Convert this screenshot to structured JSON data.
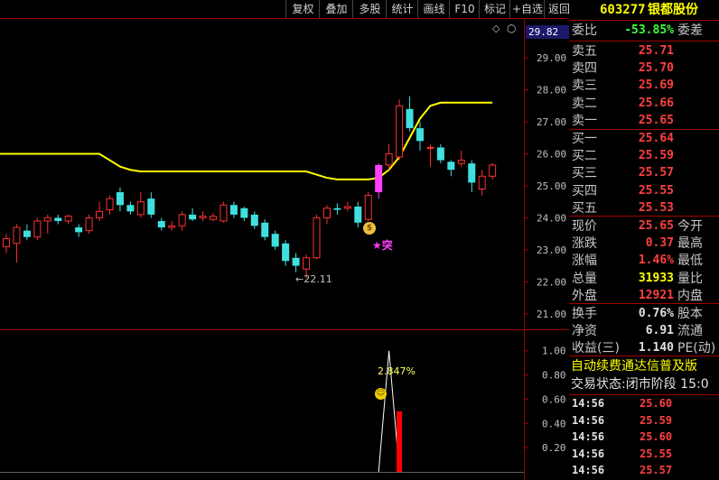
{
  "toolbar": {
    "buttons": [
      "复权",
      "叠加",
      "多股",
      "统计",
      "画线",
      "F10",
      "标记",
      "+自选",
      "返回"
    ]
  },
  "stock": {
    "code": "603277",
    "name": "银都股份"
  },
  "colors": {
    "up": "#ff3030",
    "down": "#40e0e0",
    "ma": "#ffff00",
    "flag": "#ff40ff",
    "axis": "#a00000"
  },
  "price_axis": {
    "top_label": "29.82",
    "ticks": [
      "29.00",
      "28.00",
      "27.00",
      "26.00",
      "25.00",
      "24.00",
      "23.00",
      "22.00",
      "21.00"
    ]
  },
  "indicator_axis": {
    "ticks": [
      "1.00",
      "0.80",
      "0.60",
      "0.40",
      "0.20"
    ]
  },
  "annotations": {
    "low_marker": "←22.11",
    "flag_text": "★突",
    "pct_label": "2.847%"
  },
  "quote": {
    "weibi": {
      "label": "委比",
      "value": "-53.85%",
      "label2": "委差"
    },
    "asks": [
      {
        "label": "卖五",
        "price": "25.71"
      },
      {
        "label": "卖四",
        "price": "25.70"
      },
      {
        "label": "卖三",
        "price": "25.69"
      },
      {
        "label": "卖二",
        "price": "25.66"
      },
      {
        "label": "卖一",
        "price": "25.65"
      }
    ],
    "bids": [
      {
        "label": "买一",
        "price": "25.64"
      },
      {
        "label": "买二",
        "price": "25.59"
      },
      {
        "label": "买三",
        "price": "25.57"
      },
      {
        "label": "买四",
        "price": "25.55"
      },
      {
        "label": "买五",
        "price": "25.53"
      }
    ],
    "stats": [
      {
        "label": "现价",
        "value": "25.65",
        "label2": "今开",
        "color": "#ff4040"
      },
      {
        "label": "涨跌",
        "value": "0.37",
        "label2": "最高",
        "color": "#ff4040"
      },
      {
        "label": "涨幅",
        "value": "1.46%",
        "label2": "最低",
        "color": "#ff4040"
      },
      {
        "label": "总量",
        "value": "31933",
        "label2": "量比",
        "color": "#ffff00"
      },
      {
        "label": "外盘",
        "value": "12921",
        "label2": "内盘",
        "color": "#ff4040"
      }
    ],
    "stats2": [
      {
        "label": "换手",
        "value": "0.76%",
        "label2": "股本",
        "color": "#e0e0e0"
      },
      {
        "label": "净资",
        "value": "6.91",
        "label2": "流通",
        "color": "#e0e0e0"
      },
      {
        "label": "收益(三)",
        "value": "1.140",
        "label2": "PE(动)",
        "color": "#e0e0e0"
      }
    ]
  },
  "banner": "自动续费通达信普及版",
  "trade_status": "交易状态:闭市阶段 15:0",
  "trades": [
    {
      "time": "14:56",
      "price": "25.60"
    },
    {
      "time": "14:56",
      "price": "25.59"
    },
    {
      "time": "14:56",
      "price": "25.60"
    },
    {
      "time": "14:56",
      "price": "25.55"
    },
    {
      "time": "14:56",
      "price": "25.57"
    }
  ],
  "chart_data": {
    "type": "candlestick",
    "ylim": [
      20.6,
      29.82
    ],
    "candles": [
      {
        "o": 23.1,
        "c": 23.35,
        "h": 23.5,
        "l": 22.9
      },
      {
        "o": 23.2,
        "c": 23.7,
        "h": 23.8,
        "l": 22.6
      },
      {
        "o": 23.6,
        "c": 23.4,
        "h": 23.8,
        "l": 23.3
      },
      {
        "o": 23.4,
        "c": 23.9,
        "h": 24.0,
        "l": 23.3
      },
      {
        "o": 23.9,
        "c": 24.0,
        "h": 24.1,
        "l": 23.5
      },
      {
        "o": 24.0,
        "c": 23.9,
        "h": 24.1,
        "l": 23.8
      },
      {
        "o": 23.9,
        "c": 24.05,
        "h": 24.1,
        "l": 23.8
      },
      {
        "o": 23.7,
        "c": 23.55,
        "h": 23.8,
        "l": 23.4
      },
      {
        "o": 23.6,
        "c": 24.0,
        "h": 24.1,
        "l": 23.5
      },
      {
        "o": 24.0,
        "c": 24.2,
        "h": 24.5,
        "l": 23.9
      },
      {
        "o": 24.25,
        "c": 24.6,
        "h": 24.7,
        "l": 24.1
      },
      {
        "o": 24.8,
        "c": 24.4,
        "h": 24.95,
        "l": 24.2
      },
      {
        "o": 24.4,
        "c": 24.2,
        "h": 24.5,
        "l": 24.1
      },
      {
        "o": 24.1,
        "c": 24.5,
        "h": 24.8,
        "l": 24.0
      },
      {
        "o": 24.6,
        "c": 24.1,
        "h": 24.8,
        "l": 24.0
      },
      {
        "o": 23.9,
        "c": 23.7,
        "h": 24.0,
        "l": 23.6
      },
      {
        "o": 23.7,
        "c": 23.75,
        "h": 23.9,
        "l": 23.6
      },
      {
        "o": 23.75,
        "c": 24.1,
        "h": 24.2,
        "l": 23.6
      },
      {
        "o": 24.1,
        "c": 23.95,
        "h": 24.3,
        "l": 23.9
      },
      {
        "o": 24.0,
        "c": 24.05,
        "h": 24.2,
        "l": 23.9
      },
      {
        "o": 23.95,
        "c": 24.05,
        "h": 24.15,
        "l": 23.9
      },
      {
        "o": 23.9,
        "c": 24.4,
        "h": 24.5,
        "l": 23.85
      },
      {
        "o": 24.4,
        "c": 24.1,
        "h": 24.5,
        "l": 24.0
      },
      {
        "o": 24.3,
        "c": 24.0,
        "h": 24.35,
        "l": 23.9
      },
      {
        "o": 24.1,
        "c": 23.75,
        "h": 24.2,
        "l": 23.65
      },
      {
        "o": 23.85,
        "c": 23.4,
        "h": 23.95,
        "l": 23.3
      },
      {
        "o": 23.5,
        "c": 23.1,
        "h": 23.6,
        "l": 23.0
      },
      {
        "o": 23.2,
        "c": 22.65,
        "h": 23.3,
        "l": 22.5
      },
      {
        "o": 22.75,
        "c": 22.5,
        "h": 22.9,
        "l": 22.3
      },
      {
        "o": 22.4,
        "c": 22.75,
        "h": 22.85,
        "l": 22.11
      },
      {
        "o": 22.75,
        "c": 24.0,
        "h": 24.1,
        "l": 22.7
      },
      {
        "o": 24.0,
        "c": 24.3,
        "h": 24.4,
        "l": 23.8
      },
      {
        "o": 24.3,
        "c": 24.25,
        "h": 24.45,
        "l": 24.1
      },
      {
        "o": 24.3,
        "c": 24.35,
        "h": 24.5,
        "l": 24.2
      },
      {
        "o": 24.35,
        "c": 23.85,
        "h": 24.5,
        "l": 23.7
      },
      {
        "o": 23.95,
        "c": 24.7,
        "h": 24.8,
        "l": 23.9
      },
      {
        "o": 24.8,
        "c": 25.65,
        "h": 25.7,
        "l": 24.6
      },
      {
        "o": 25.65,
        "c": 26.0,
        "h": 26.3,
        "l": 25.5
      },
      {
        "o": 25.9,
        "c": 27.5,
        "h": 27.7,
        "l": 25.8
      },
      {
        "o": 27.4,
        "c": 26.8,
        "h": 27.8,
        "l": 26.7
      },
      {
        "o": 26.8,
        "c": 26.4,
        "h": 27.0,
        "l": 26.1
      },
      {
        "o": 26.2,
        "c": 26.2,
        "h": 26.3,
        "l": 25.6
      },
      {
        "o": 26.2,
        "c": 25.8,
        "h": 26.3,
        "l": 25.7
      },
      {
        "o": 25.75,
        "c": 25.5,
        "h": 25.8,
        "l": 25.3
      },
      {
        "o": 25.7,
        "c": 25.8,
        "h": 26.1,
        "l": 25.6
      },
      {
        "o": 25.7,
        "c": 25.1,
        "h": 25.8,
        "l": 24.8
      },
      {
        "o": 24.9,
        "c": 25.3,
        "h": 25.5,
        "l": 24.7
      },
      {
        "o": 25.3,
        "c": 25.65,
        "h": 25.71,
        "l": 25.2
      }
    ],
    "ma": [
      26.0,
      26.0,
      26.0,
      26.0,
      26.0,
      26.0,
      26.0,
      26.0,
      26.0,
      26.0,
      25.8,
      25.6,
      25.5,
      25.45,
      25.45,
      25.45,
      25.45,
      25.45,
      25.45,
      25.45,
      25.45,
      25.45,
      25.45,
      25.45,
      25.45,
      25.45,
      25.45,
      25.45,
      25.45,
      25.45,
      25.35,
      25.25,
      25.2,
      25.2,
      25.2,
      25.2,
      25.25,
      25.5,
      25.9,
      26.5,
      27.1,
      27.5,
      27.6,
      27.6,
      27.6,
      27.6,
      27.6,
      27.6
    ],
    "indicator": {
      "ylim": [
        0,
        1.08
      ],
      "line": [
        {
          "i": 36,
          "v": 0
        },
        {
          "i": 37,
          "v": 1.0
        },
        {
          "i": 38,
          "v": 0
        }
      ],
      "bar": {
        "i": 38,
        "v": 0.5
      }
    }
  }
}
